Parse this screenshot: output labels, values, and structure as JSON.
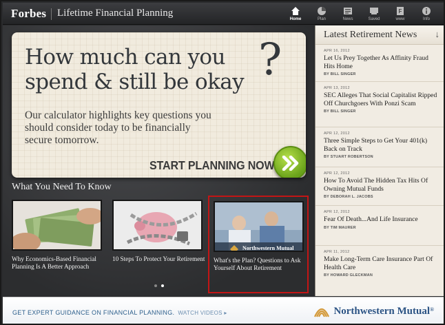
{
  "header": {
    "brand": "Forbes",
    "title": "Lifetime Financial Planning",
    "nav": [
      {
        "label": "Home",
        "icon": "home-icon"
      },
      {
        "label": "Plan",
        "icon": "pie-chart-icon"
      },
      {
        "label": "News",
        "icon": "news-icon"
      },
      {
        "label": "Saved",
        "icon": "saved-icon"
      },
      {
        "label": "www",
        "icon": "web-icon"
      },
      {
        "label": "Info",
        "icon": "info-icon"
      }
    ]
  },
  "hero": {
    "headline": "How much can you spend & still be okay",
    "question_mark": "?",
    "subtext": "Our calculator highlights key questions you should consider today to be financially secure tomorrow.",
    "cta": "START PLANNING NOW",
    "accent": "#7cb324"
  },
  "section": {
    "title": "What You Need To Know"
  },
  "cards": [
    {
      "caption": "Why Economics-Based Financial Planning Is A Better Approach"
    },
    {
      "caption": "10 Steps To Protect Your Retirement"
    },
    {
      "caption": "What's the Plan? Questions to Ask Yourself About Retirement",
      "thumb_brand": "Northwestern Mutual"
    }
  ],
  "pager": {
    "pages": 2,
    "current": 2
  },
  "sidebar": {
    "title": "Latest Retirement News",
    "items": [
      {
        "date": "APR 16, 2012",
        "headline": "Let Us Prey Together As Affinity Fraud Hits Home",
        "byline": "BY BILL SINGER"
      },
      {
        "date": "APR 13, 2012",
        "headline": "SEC Alleges That Social Capitalist Ripped Off Churchgoers With Ponzi Scam",
        "byline": "BY BILL SINGER"
      },
      {
        "date": "APR 12, 2012",
        "headline": "Three Simple Steps to Get Your 401(k) Back on Track",
        "byline": "BY STUART ROBERTSON"
      },
      {
        "date": "APR 12, 2012",
        "headline": "How To Avoid The Hidden Tax Hits Of Owning Mutual Funds",
        "byline": "BY DEBORAH L. JACOBS"
      },
      {
        "date": "APR 12, 2012",
        "headline": "Fear Of Death...And Life Insurance",
        "byline": "BY TIM MAURER"
      },
      {
        "date": "APR 11, 2012",
        "headline": "Make Long-Term Care Insurance Part Of Health Care",
        "byline": "BY HOWARD GLECKMAN"
      }
    ]
  },
  "banner": {
    "cta": "GET EXPERT GUIDANCE ON FINANCIAL PLANNING.",
    "link": "WATCH VIDEOS ▸",
    "brand": "Northwestern Mutual",
    "brand_suffix": "®"
  }
}
